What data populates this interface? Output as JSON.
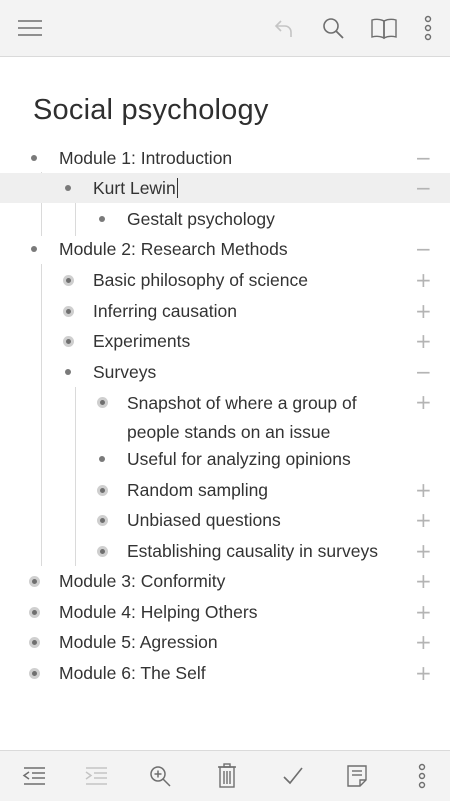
{
  "app": {
    "title": "Social psychology"
  },
  "toolbar_top": {
    "icons": [
      "menu-icon",
      "undo-icon",
      "search-icon",
      "book-icon",
      "more-vertical-icon"
    ]
  },
  "outline": [
    {
      "text": "Module 1: Introduction",
      "bullet": "dot",
      "control": "−"
    },
    {
      "text": "Kurt Lewin",
      "bullet": "dot",
      "control": "−",
      "selected": true
    },
    {
      "text": "Gestalt psychology",
      "bullet": "dot",
      "control": ""
    },
    {
      "text": "Module 2: Research Methods",
      "bullet": "dot",
      "control": "−"
    },
    {
      "text": "Basic philosophy of science",
      "bullet": "ring",
      "control": "+"
    },
    {
      "text": "Inferring causation",
      "bullet": "ring",
      "control": "+"
    },
    {
      "text": "Experiments",
      "bullet": "ring",
      "control": "+"
    },
    {
      "text": "Surveys",
      "bullet": "dot",
      "control": "−"
    },
    {
      "text": "Snapshot of where a group of people stands on an issue",
      "bullet": "ring",
      "control": "+"
    },
    {
      "text": "Useful for analyzing opinions",
      "bullet": "dot",
      "control": ""
    },
    {
      "text": "Random sampling",
      "bullet": "ring",
      "control": "+"
    },
    {
      "text": "Unbiased questions",
      "bullet": "ring",
      "control": "+"
    },
    {
      "text": "Establishing causality in surveys",
      "bullet": "ring",
      "control": "+"
    },
    {
      "text": "Module 3: Conformity",
      "bullet": "ring",
      "control": "+"
    },
    {
      "text": "Module 4: Helping Others",
      "bullet": "ring",
      "control": "+"
    },
    {
      "text": "Module 5: Agression",
      "bullet": "ring",
      "control": "+"
    },
    {
      "text": "Module 6: The Self",
      "bullet": "ring",
      "control": "+"
    }
  ],
  "toolbar_bottom": {
    "icons": [
      "outdent-icon",
      "indent-icon",
      "zoom-in-icon",
      "trash-icon",
      "check-icon",
      "note-icon",
      "more-vertical-icon"
    ]
  },
  "colors": {
    "bar_background": "#f3f3f3",
    "highlight": "#efefef",
    "text": "#333333",
    "icon": "#6e6e6e",
    "icon_disabled": "#c4c4c4"
  }
}
